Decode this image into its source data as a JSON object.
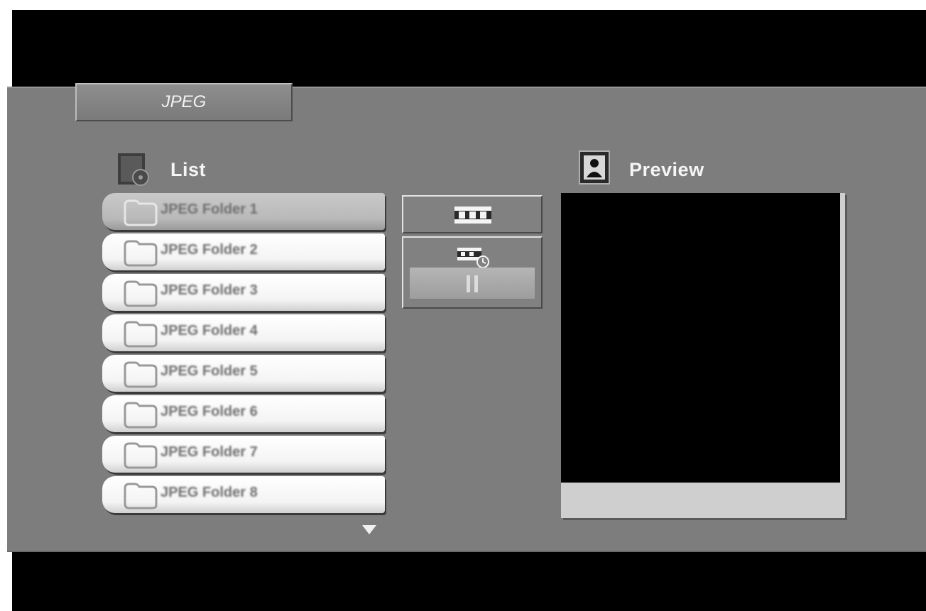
{
  "header": {
    "mode_label": "JPEG"
  },
  "list_section": {
    "title": "List",
    "icon": "folder-list-icon",
    "items": [
      {
        "label": "JPEG Folder 1",
        "selected": true
      },
      {
        "label": "JPEG Folder 2",
        "selected": false
      },
      {
        "label": "JPEG Folder 3",
        "selected": false
      },
      {
        "label": "JPEG Folder 4",
        "selected": false
      },
      {
        "label": "JPEG Folder 5",
        "selected": false
      },
      {
        "label": "JPEG Folder 6",
        "selected": false
      },
      {
        "label": "JPEG Folder 7",
        "selected": false
      },
      {
        "label": "JPEG Folder 8",
        "selected": false
      }
    ],
    "scroll_indicator": "down-arrow-icon"
  },
  "controls": {
    "slideshow_icon": "film-strip-icon",
    "slide_speed_icon": "film-strip-clock-icon",
    "speed_level_icon": "pause-bars-icon"
  },
  "preview_section": {
    "title": "Preview",
    "icon": "portrait-icon",
    "caption": ""
  },
  "colors": {
    "panel": "#7d7d7d",
    "item_background": "#f4f4f4",
    "item_selected": "#b9b9b9",
    "screen_background": "#000000"
  }
}
